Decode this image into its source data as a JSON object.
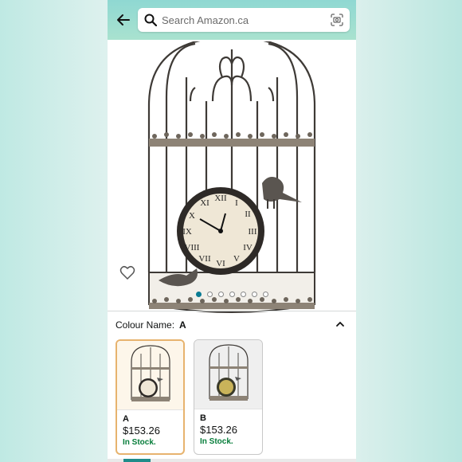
{
  "search": {
    "placeholder": "Search Amazon.ca"
  },
  "gallery": {
    "image_count": 7,
    "active_index": 0
  },
  "variation": {
    "label": "Colour Name:",
    "value": "A"
  },
  "swatches": [
    {
      "name": "A",
      "price": "$153.26",
      "stock": "In Stock."
    },
    {
      "name": "B",
      "price": "$153.26",
      "stock": "In Stock."
    }
  ],
  "colors": {
    "header": "#8fd8d2",
    "accent": "#0a7b93",
    "stock": "#067d3a",
    "selected_border": "#e7b36e"
  }
}
